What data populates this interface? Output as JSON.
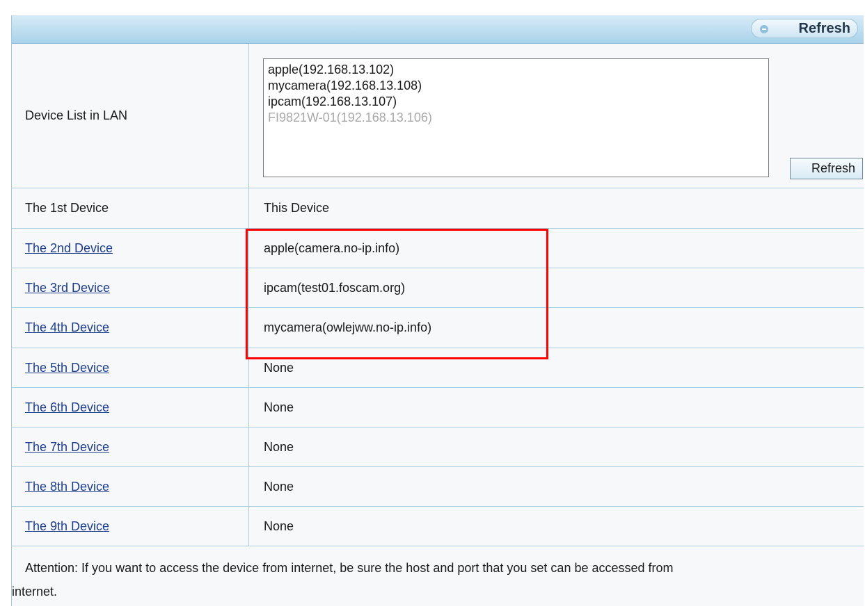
{
  "header": {
    "refresh_label": "Refresh"
  },
  "lan": {
    "label": "Device List in LAN",
    "devices": [
      "apple(192.168.13.102)",
      "mycamera(192.168.13.108)",
      "ipcam(192.168.13.107)",
      "FI9821W-01(192.168.13.106)"
    ],
    "refresh_label": "Refresh"
  },
  "device_rows": [
    {
      "label": "The 1st Device",
      "value": "This Device"
    },
    {
      "label": "The 2nd Device",
      "value": "apple(camera.no-ip.info)"
    },
    {
      "label": "The 3rd Device",
      "value": "ipcam(test01.foscam.org)"
    },
    {
      "label": "The 4th Device",
      "value": "mycamera(owlejww.no-ip.info)"
    },
    {
      "label": "The 5th Device",
      "value": "None"
    },
    {
      "label": "The 6th Device",
      "value": "None"
    },
    {
      "label": "The 7th Device",
      "value": "None"
    },
    {
      "label": "The 8th Device",
      "value": "None"
    },
    {
      "label": "The 9th Device",
      "value": "None"
    }
  ],
  "attention": {
    "line1": "Attention: If you want to access the device from internet, be sure the host and port that you set can be accessed from",
    "line2": "internet."
  },
  "colors": {
    "highlight_box": "#ff0000",
    "link": "#1d3c8c"
  }
}
